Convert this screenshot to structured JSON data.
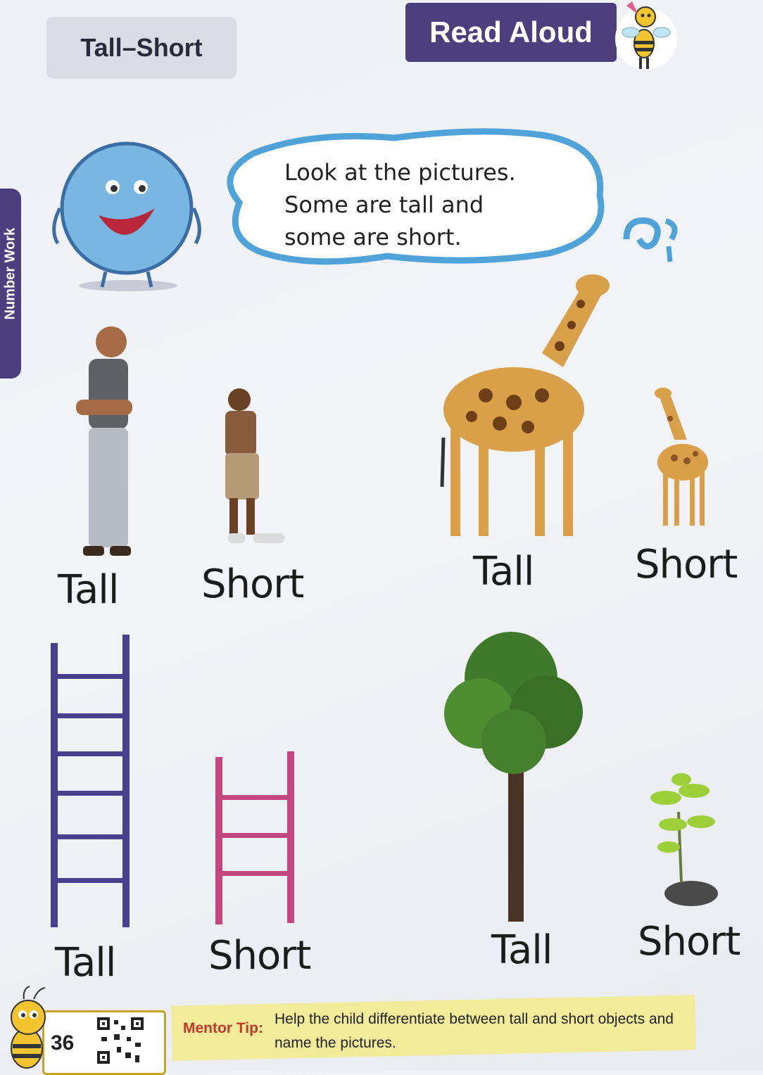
{
  "header": {
    "title": "Tall–Short",
    "read_aloud": "Read Aloud",
    "side_tab": "Number Work"
  },
  "speech_bubble": {
    "lines": [
      "Look at the pictures.",
      "Some are tall and",
      "some are short."
    ]
  },
  "pictures": [
    {
      "subject": "man",
      "label": "Tall"
    },
    {
      "subject": "boy",
      "label": "Short"
    },
    {
      "subject": "giraffe",
      "label": "Tall"
    },
    {
      "subject": "baby-giraffe",
      "label": "Short"
    },
    {
      "subject": "purple-ladder",
      "label": "Tall"
    },
    {
      "subject": "pink-ladder",
      "label": "Short"
    },
    {
      "subject": "tree",
      "label": "Tall"
    },
    {
      "subject": "sapling",
      "label": "Short"
    }
  ],
  "footer": {
    "page_number": "36",
    "mentor_title": "Mentor Tip:",
    "mentor_text": "Help the child differentiate between tall and short objects and name the pictures."
  },
  "colors": {
    "brand_purple": "#4b3f7e",
    "tab_grey": "#dcdce6",
    "ladder_tall": "#4a3f8c",
    "ladder_short": "#c2477e",
    "mentor_bg": "#f2eb9a",
    "mentor_title": "#c0392b"
  }
}
